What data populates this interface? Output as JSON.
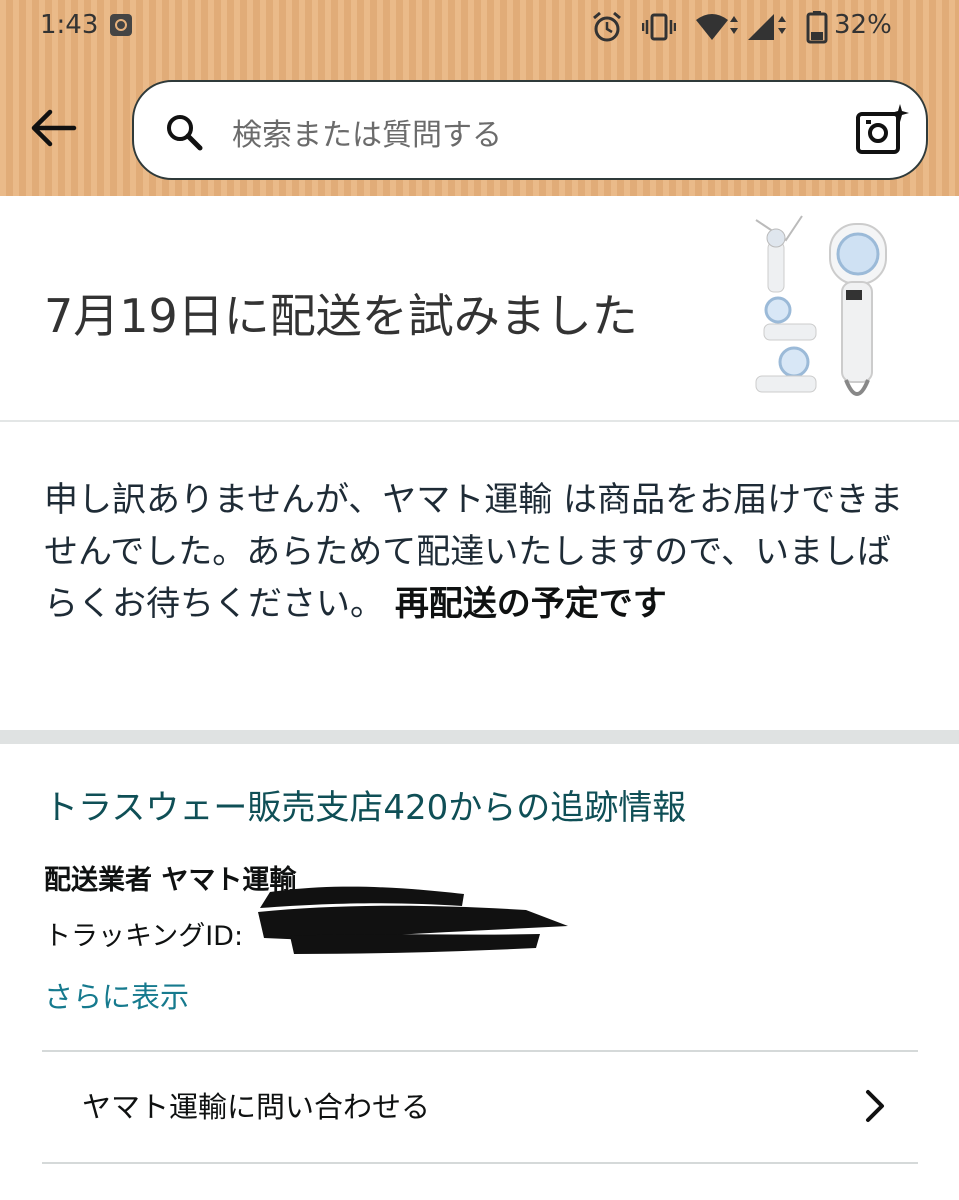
{
  "status_bar": {
    "time": "1:43",
    "battery_percent": "32%"
  },
  "header": {
    "search_placeholder": "検索または質問する"
  },
  "delivery": {
    "headline": "7月19日に配送を試みました",
    "message_plain": "申し訳ありませんが、ヤマト運輸 は商品をお届けできませんでした。あらためて配達いたしますので、いましばらくお待ちください。 ",
    "message_bold": "再配送の予定です"
  },
  "tracking": {
    "title": "トラスウェー販売支店420からの追跡情報",
    "carrier_line": "配送業者 ヤマト運輸",
    "tracking_id_label": "トラッキングID:",
    "show_more": "さらに表示"
  },
  "contact": {
    "label": "ヤマト運輸に問い合わせる"
  },
  "colors": {
    "header_bg": "#e8b27c",
    "link": "#167a8e",
    "title": "#0f4f56"
  },
  "icons": [
    "back-arrow-icon",
    "search-icon",
    "camera-icon",
    "alarm-icon",
    "vibrate-icon",
    "wifi-icon",
    "signal-icon",
    "battery-icon",
    "chevron-right-icon"
  ]
}
